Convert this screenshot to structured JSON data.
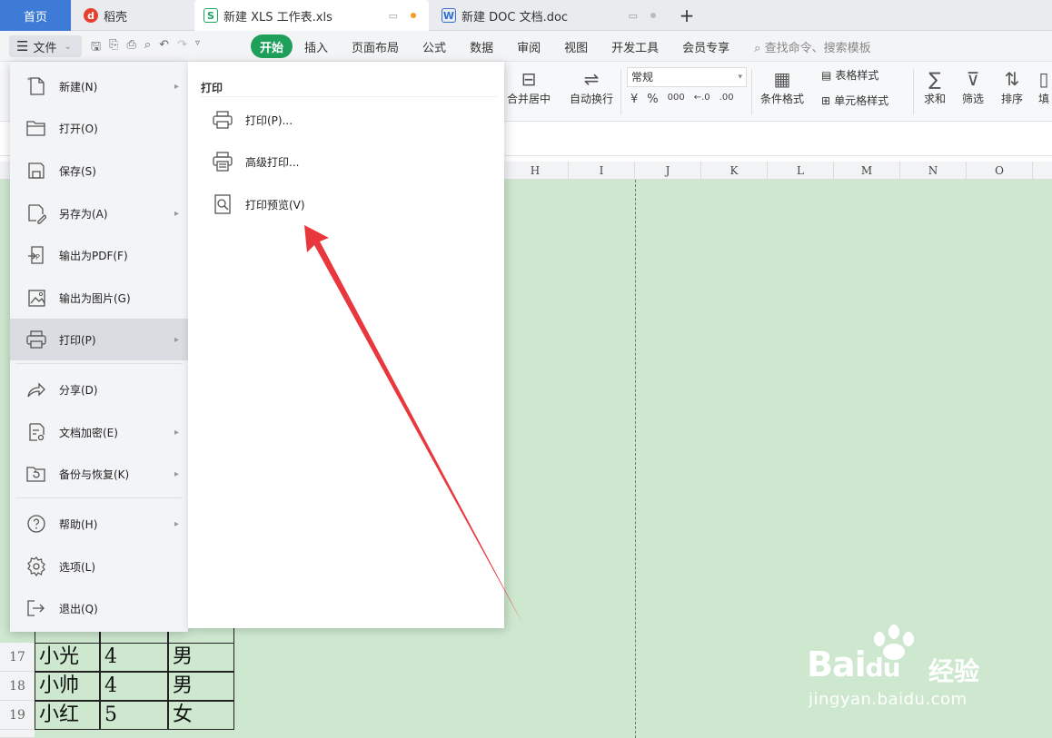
{
  "tabs": {
    "home": "首页",
    "daoke": "稻壳",
    "xls": "新建 XLS 工作表.xls",
    "doc": "新建 DOC 文档.doc",
    "plus": "+"
  },
  "menubar": {
    "file_label": "文件",
    "ribbon_tabs": [
      "开始",
      "插入",
      "页面布局",
      "公式",
      "数据",
      "审阅",
      "视图",
      "开发工具",
      "会员专享"
    ],
    "search_placeholder": "查找命令、搜索模板"
  },
  "toolbar": {
    "merge": "合并居中",
    "wrap": "自动换行",
    "number_format": "常规",
    "currency": "¥",
    "percent": "%",
    "conditional": "条件格式",
    "table_style": "表格样式",
    "cell_style": "单元格样式",
    "sum": "求和",
    "filter": "筛选",
    "sort": "排序",
    "fill": "填"
  },
  "grid": {
    "columns": [
      "H",
      "I",
      "J",
      "K",
      "L",
      "M",
      "N",
      "O"
    ],
    "rows": [
      {
        "num": "17",
        "name": "小光",
        "grade": "4",
        "sex": "男"
      },
      {
        "num": "18",
        "name": "小帅",
        "grade": "4",
        "sex": "男"
      },
      {
        "num": "19",
        "name": "小红",
        "grade": "5",
        "sex": "女"
      }
    ]
  },
  "file_menu": {
    "items": [
      {
        "label": "新建(N)",
        "icon": "new-file-icon",
        "submenu": true
      },
      {
        "label": "打开(O)",
        "icon": "folder-open-icon",
        "submenu": false
      },
      {
        "label": "保存(S)",
        "icon": "save-icon",
        "submenu": false
      },
      {
        "label": "另存为(A)",
        "icon": "save-as-icon",
        "submenu": true
      },
      {
        "label": "输出为PDF(F)",
        "icon": "export-pdf-icon",
        "submenu": false
      },
      {
        "label": "输出为图片(G)",
        "icon": "export-image-icon",
        "submenu": false
      },
      {
        "label": "打印(P)",
        "icon": "printer-icon",
        "submenu": true,
        "active": true
      },
      {
        "label": "分享(D)",
        "icon": "share-icon",
        "submenu": false
      },
      {
        "label": "文档加密(E)",
        "icon": "encrypt-icon",
        "submenu": true
      },
      {
        "label": "备份与恢复(K)",
        "icon": "backup-icon",
        "submenu": true
      },
      {
        "label": "帮助(H)",
        "icon": "help-icon",
        "submenu": true
      },
      {
        "label": "选项(L)",
        "icon": "gear-icon",
        "submenu": false
      },
      {
        "label": "退出(Q)",
        "icon": "exit-icon",
        "submenu": false
      }
    ]
  },
  "print_submenu": {
    "title": "打印",
    "items": [
      {
        "label": "打印(P)...",
        "icon": "printer-icon"
      },
      {
        "label": "高级打印...",
        "icon": "advanced-print-icon"
      },
      {
        "label": "打印预览(V)",
        "icon": "print-preview-icon"
      }
    ]
  },
  "watermark": {
    "brand": "Bai",
    "brand2": "du",
    "service": "经验",
    "url": "jingyan.baidu.com"
  },
  "colors": {
    "accent_green": "#1fa05a",
    "home_tab": "#3e7bd6",
    "sheet_bg": "#cde8cf",
    "arrow": "#e8383d"
  }
}
